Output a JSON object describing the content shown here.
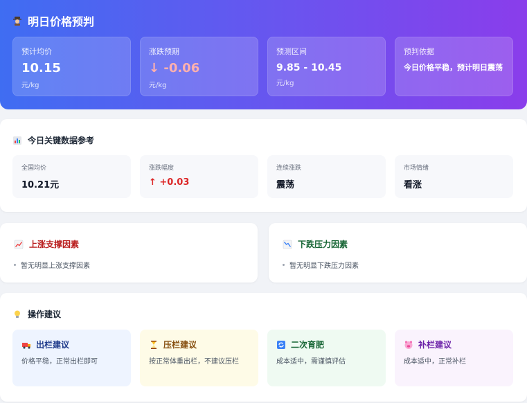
{
  "hero": {
    "title": "明日价格预判",
    "cards": [
      {
        "label": "预计均价",
        "value": "10.15",
        "unit": "元/kg"
      },
      {
        "label": "涨跌预期",
        "value": "↓ -0.06",
        "unit": "元/kg"
      },
      {
        "label": "预测区间",
        "value": "9.85 - 10.45",
        "unit": "元/kg"
      },
      {
        "label": "预判依据",
        "value": "今日价格平稳，预计明日震荡"
      }
    ]
  },
  "key_data": {
    "title": "今日关键数据参考",
    "cards": [
      {
        "label": "全国均价",
        "value": "10.21元"
      },
      {
        "label": "涨跌幅度",
        "value": "↑ +0.03"
      },
      {
        "label": "连续涨跌",
        "value": "震荡"
      },
      {
        "label": "市场情绪",
        "value": "看涨"
      }
    ]
  },
  "factors": {
    "up": {
      "title": "上涨支撑因素",
      "item": "暂无明显上涨支撑因素"
    },
    "down": {
      "title": "下跌压力因素",
      "item": "暂无明显下跌压力因素"
    }
  },
  "advice": {
    "title": "操作建议",
    "cards": [
      {
        "title": "出栏建议",
        "text": "价格平稳，正常出栏即可",
        "icon": "truck-icon"
      },
      {
        "title": "压栏建议",
        "text": "按正常体重出栏，不建议压栏",
        "icon": "hourglass-icon"
      },
      {
        "title": "二次育肥",
        "text": "成本适中，需谨慎评估",
        "icon": "refresh-icon"
      },
      {
        "title": "补栏建议",
        "text": "成本适中，正常补栏",
        "icon": "pig-icon"
      }
    ]
  },
  "colors": {
    "hero_start": "#3f6df2",
    "hero_end": "#8a3deb",
    "up": "#dc2626",
    "down_value": "#ffb0ae"
  }
}
